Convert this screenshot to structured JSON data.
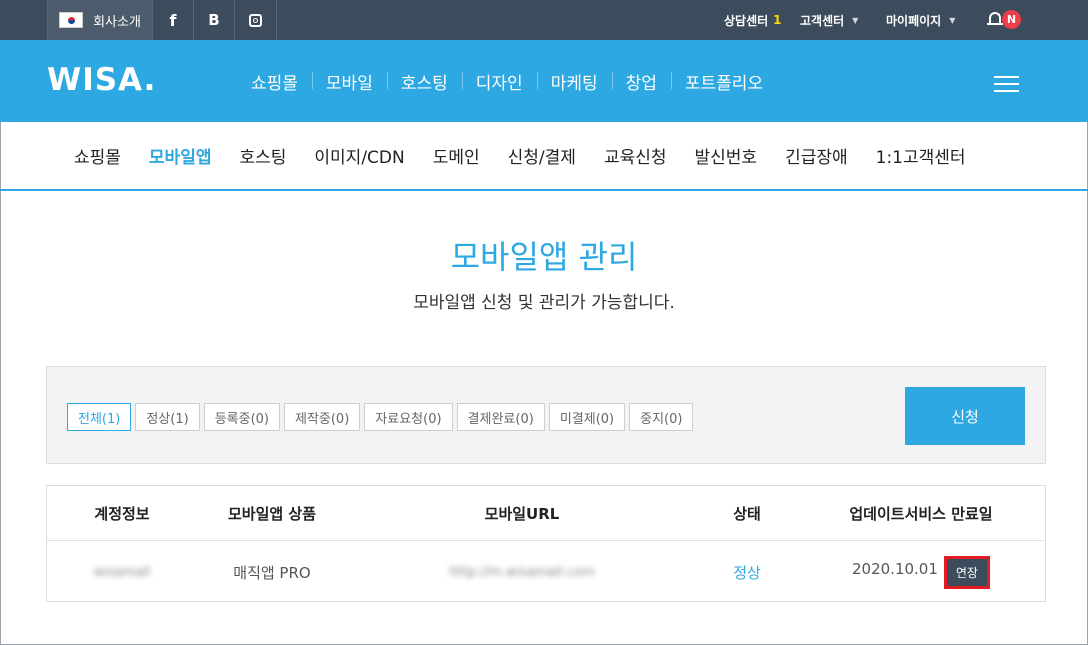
{
  "topbar": {
    "company": "회사소개",
    "facebook": "f",
    "blog": "B",
    "consult_label": "상담센터",
    "consult_number": "1",
    "support_label": "고객센터",
    "mypage_label": "마이페이지",
    "notification_badge": "N"
  },
  "header": {
    "logo": "WISA.",
    "nav": [
      "쇼핑몰",
      "모바일",
      "호스팅",
      "디자인",
      "마케팅",
      "창업",
      "포트폴리오"
    ]
  },
  "subnav": {
    "items": [
      "쇼핑몰",
      "모바일앱",
      "호스팅",
      "이미지/CDN",
      "도메인",
      "신청/결제",
      "교육신청",
      "발신번호",
      "긴급장애",
      "1:1고객센터"
    ],
    "active": "모바일앱"
  },
  "page": {
    "title": "모바일앱 관리",
    "subtitle": "모바일앱 신청 및 관리가 가능합니다."
  },
  "filters": {
    "items": [
      "전체(1)",
      "정상(1)",
      "등록중(0)",
      "제작중(0)",
      "자료요청(0)",
      "결제완료(0)",
      "미결제(0)",
      "중지(0)"
    ],
    "active": "전체(1)",
    "apply_label": "신청"
  },
  "table": {
    "headers": [
      "계정정보",
      "모바일앱 상품",
      "모바일URL",
      "상태",
      "업데이트서비스 만료일"
    ],
    "rows": [
      {
        "account": "wisamall",
        "product": "매직앱 PRO",
        "url": "http://m.wisamall.com",
        "status": "정상",
        "expiry": "2020.10.01",
        "action": "연장"
      }
    ]
  },
  "colors": {
    "accent": "#2ea8e2",
    "topbar": "#3d4c5c",
    "highlight": "#e31b23"
  }
}
